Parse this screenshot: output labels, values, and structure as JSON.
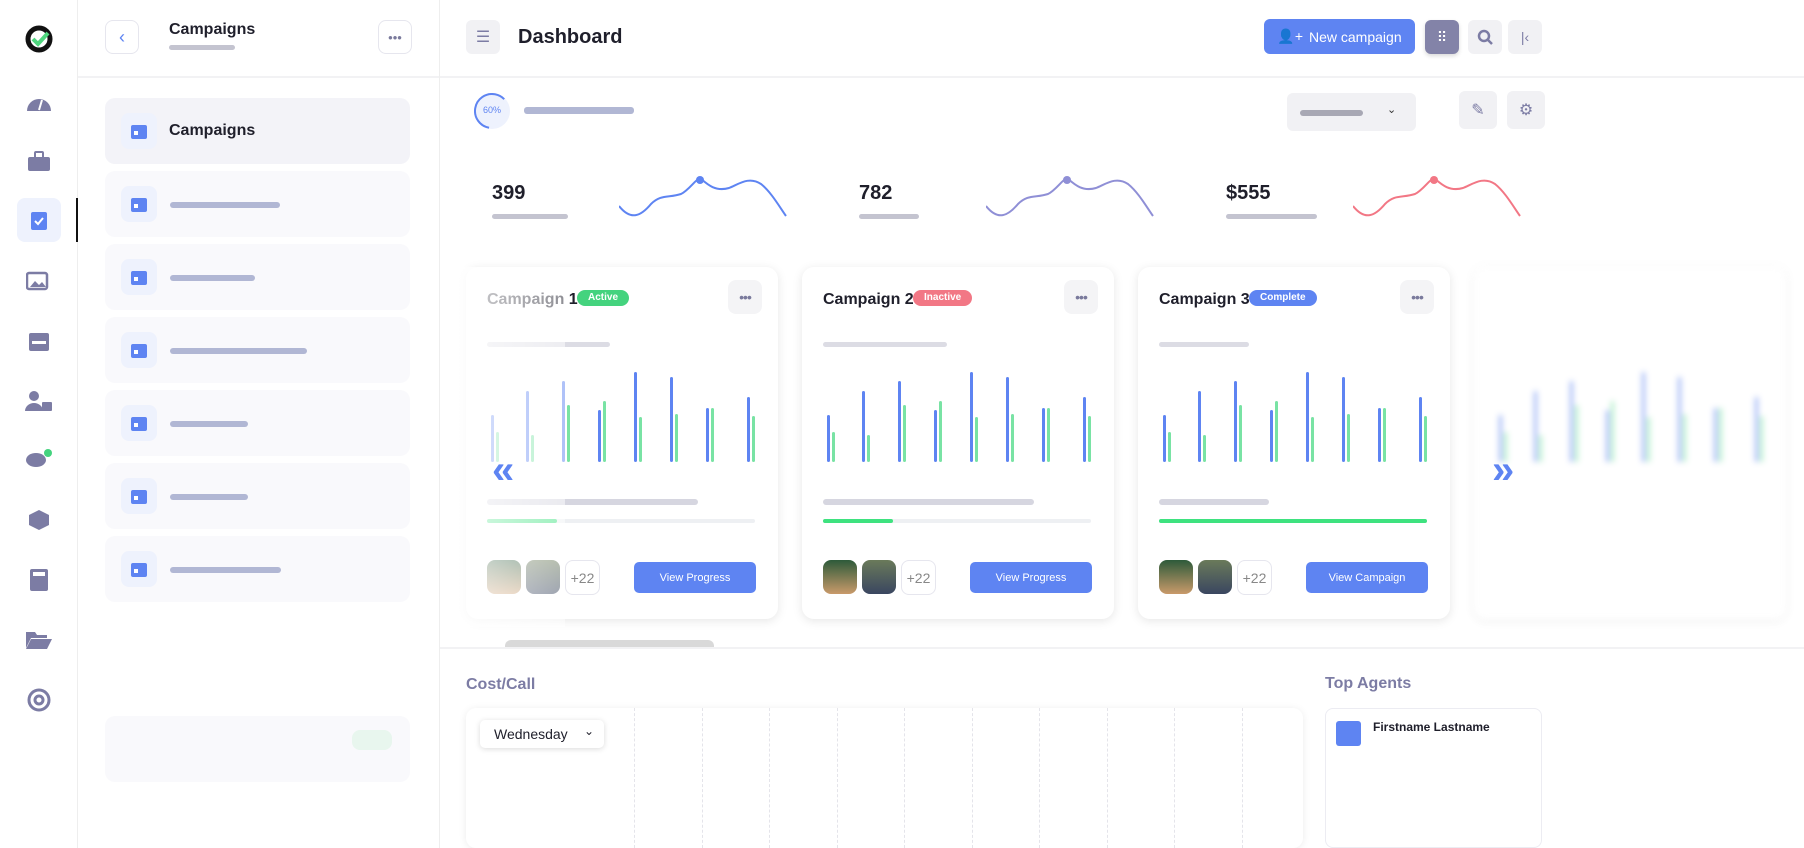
{
  "colors": {
    "accent": "#5e84f2",
    "green": "#3ee27f",
    "active": "#44d37e",
    "inactive": "#f27785",
    "complete": "#5e84f2",
    "icon": "#7c7ca4"
  },
  "rail": {
    "icons": [
      "logo-icon",
      "dashboard-gauge-icon",
      "toolbox-icon",
      "clipboard-check-icon",
      "images-icon",
      "calendar-icon",
      "user-lock-icon",
      "chat-icon",
      "box-icon",
      "calculator-icon",
      "folder-open-icon",
      "target-icon"
    ],
    "active": "clipboard-check-icon"
  },
  "panel": {
    "title": "Campaigns",
    "active_item": "Campaigns"
  },
  "header": {
    "title": "Dashboard",
    "new_campaign": "New campaign"
  },
  "progress": {
    "label": "60%",
    "value": 60
  },
  "stats": [
    {
      "value": "399",
      "color": "#5e84f2"
    },
    {
      "value": "782",
      "color": "#8f8fd6"
    },
    {
      "value": "$555",
      "color": "#f27785"
    }
  ],
  "cards": [
    {
      "title": "Campaign 1",
      "status": "Active",
      "status_color": "#44d37e",
      "progress": 26,
      "more": "+22",
      "button": "View Progress"
    },
    {
      "title": "Campaign 2",
      "status": "Inactive",
      "status_color": "#f27785",
      "progress": 26,
      "more": "+22",
      "button": "View Progress"
    },
    {
      "title": "Campaign 3",
      "status": "Complete",
      "status_color": "#5e84f2",
      "progress": 100,
      "more": "+22",
      "button": "View Campaign"
    }
  ],
  "bar_pairs": [
    [
      47,
      30
    ],
    [
      71,
      27
    ],
    [
      81,
      57
    ],
    [
      52,
      61
    ],
    [
      90,
      45
    ],
    [
      85,
      48
    ],
    [
      54,
      54
    ],
    [
      65,
      46
    ]
  ],
  "cost_call": {
    "title": "Cost/Call",
    "day": "Wednesday"
  },
  "top_agents": {
    "title": "Top Agents",
    "agent": "Firstname Lastname"
  }
}
